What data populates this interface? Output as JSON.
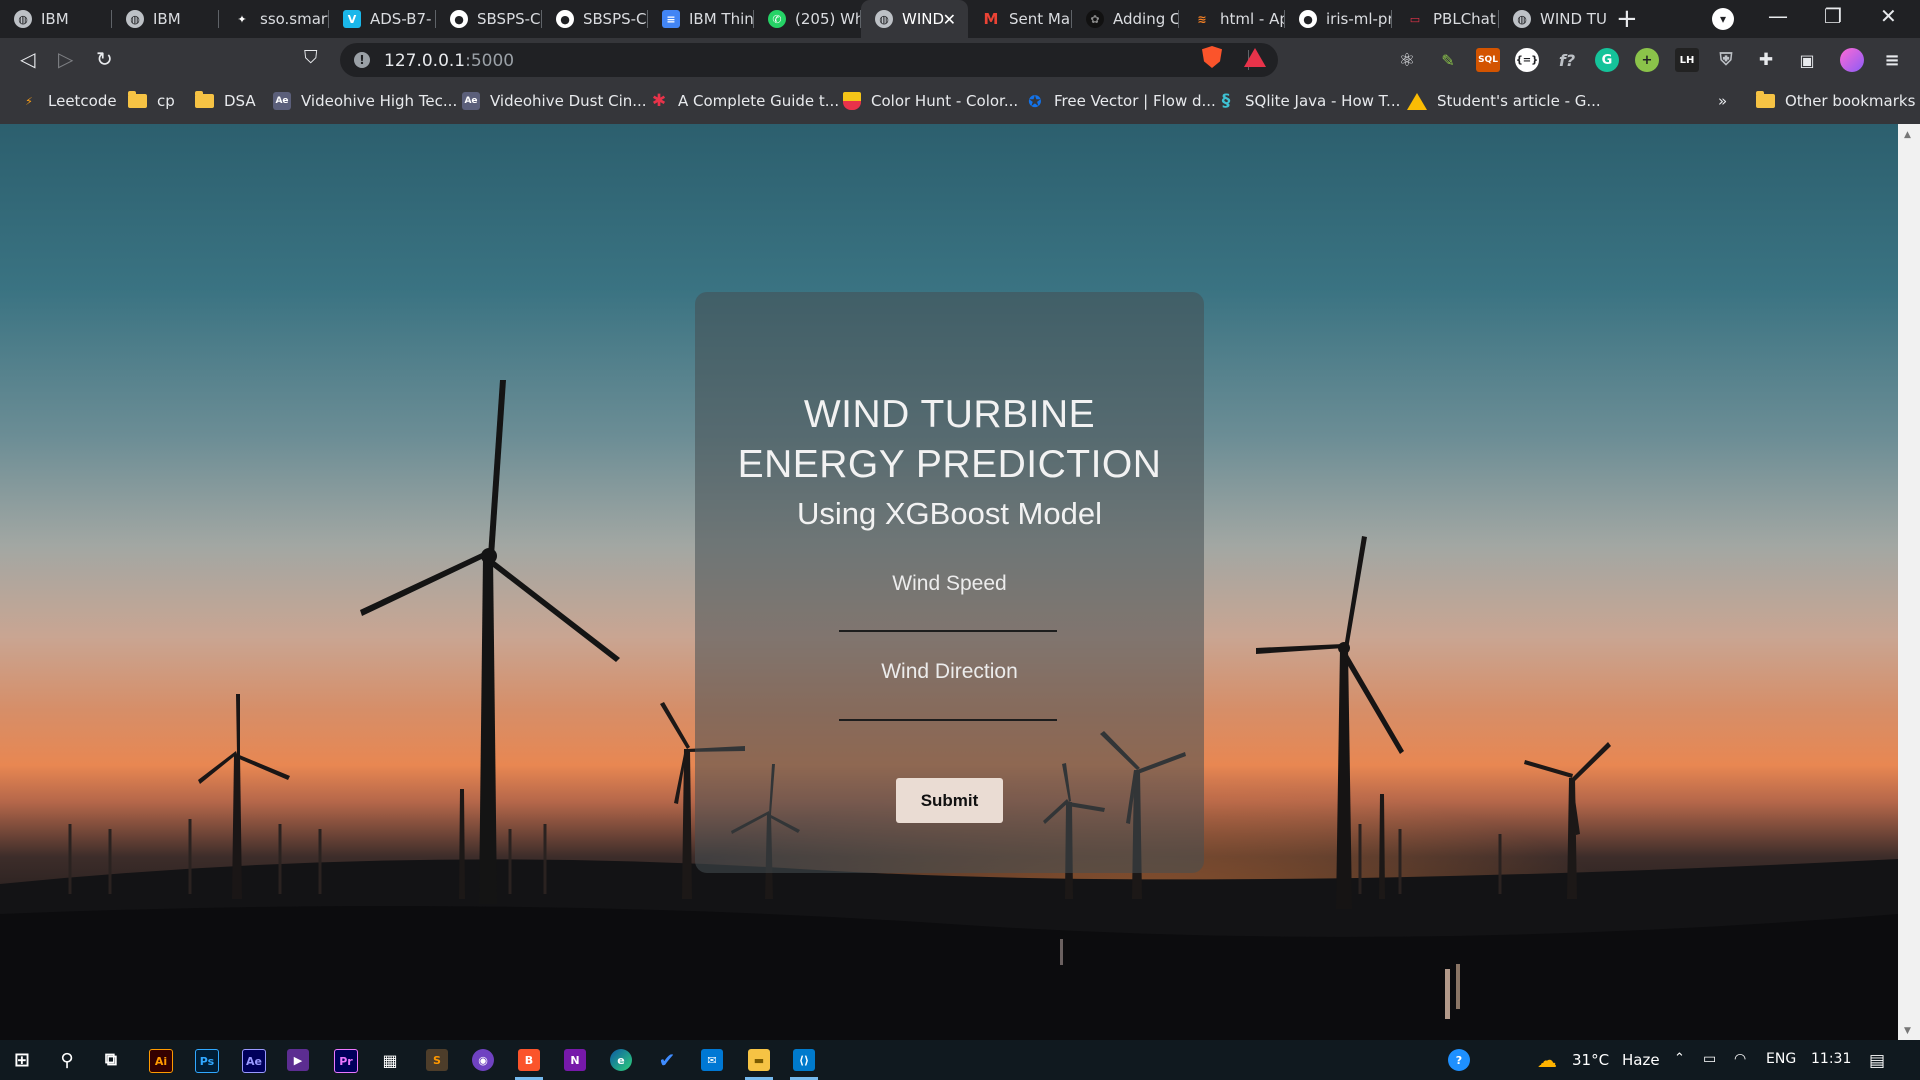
{
  "browser": {
    "tabs": [
      {
        "title": "IBM",
        "icon": "globe-icon"
      },
      {
        "title": "IBM",
        "icon": "globe-icon"
      },
      {
        "title": "sso.smart",
        "icon": "pinwheel-icon"
      },
      {
        "title": "ADS-B7-",
        "icon": "vimeo-icon"
      },
      {
        "title": "SBSPS-Cl",
        "icon": "github-icon"
      },
      {
        "title": "SBSPS-Cl",
        "icon": "github-icon"
      },
      {
        "title": "IBM Thin",
        "icon": "docs-icon"
      },
      {
        "title": "(205) Wh",
        "icon": "whatsapp-icon"
      },
      {
        "title": "WIND",
        "icon": "globe-icon",
        "active": true
      },
      {
        "title": "Sent Mai",
        "icon": "gmail-icon"
      },
      {
        "title": "Adding C",
        "icon": "openai-icon"
      },
      {
        "title": "html - Ap",
        "icon": "stackoverflow-icon"
      },
      {
        "title": "iris-ml-pr",
        "icon": "github-icon"
      },
      {
        "title": "PBLChat",
        "icon": "chat-icon"
      },
      {
        "title": "WIND TU",
        "icon": "globe-icon"
      }
    ],
    "url_host": "127.0.0.1",
    "url_port": ":5000",
    "bookmarks": [
      {
        "label": "Leetcode",
        "icon": "leetcode-icon"
      },
      {
        "label": "cp",
        "icon": "folder-icon"
      },
      {
        "label": "DSA",
        "icon": "folder-icon"
      },
      {
        "label": "Videohive High Tec...",
        "icon": "videohive-icon"
      },
      {
        "label": "Videohive Dust Cin...",
        "icon": "videohive-icon"
      },
      {
        "label": "A Complete Guide t...",
        "icon": "asterisk-icon"
      },
      {
        "label": "Color Hunt - Color...",
        "icon": "colorhunt-icon"
      },
      {
        "label": "Free Vector | Flow d...",
        "icon": "freepik-icon"
      },
      {
        "label": "SQlite Java - How T...",
        "icon": "sqlite-icon"
      },
      {
        "label": "Student's article - G...",
        "icon": "drive-icon"
      }
    ],
    "bookmarks_overflow": "»",
    "other_bookmarks": "Other bookmarks"
  },
  "page": {
    "title_line1": "WIND TURBINE",
    "title_line2": "ENERGY PREDICTION",
    "subtitle": "Using XGBoost Model",
    "field1_label": "Wind Speed",
    "field1_value": "",
    "field2_label": "Wind Direction",
    "field2_value": "",
    "submit_label": "Submit"
  },
  "taskbar": {
    "apps": [
      "windows-start-icon",
      "search-icon",
      "task-view-icon",
      "illustrator-icon",
      "photoshop-icon",
      "after-effects-icon",
      "visual-studio-icon",
      "premiere-icon",
      "calculator-icon",
      "sublime-icon",
      "github-desktop-icon",
      "brave-icon",
      "onenote-icon",
      "edge-icon",
      "todo-icon",
      "mail-icon",
      "file-explorer-icon",
      "vscode-icon"
    ],
    "weather": "31°C",
    "weather_desc": "Haze",
    "language": "ENG",
    "time": "11:31"
  },
  "colors": {
    "accent_submit_bg": "#eadcd3",
    "card_bg": "rgba(70,78,82,0.55)",
    "tab_active": "#35363a"
  }
}
